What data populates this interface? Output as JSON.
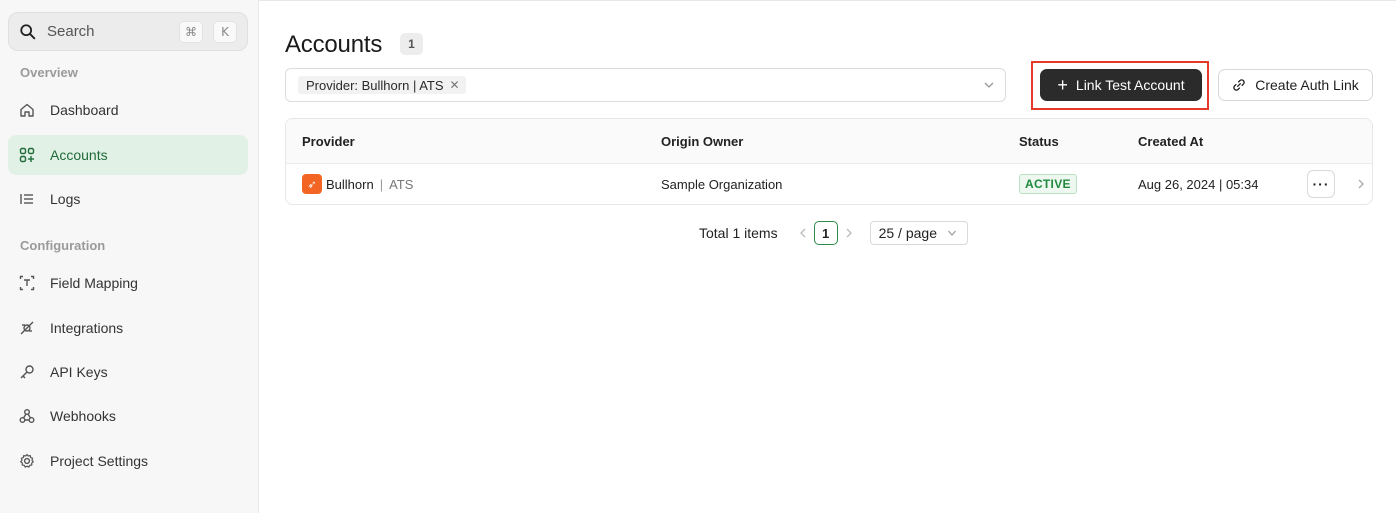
{
  "search": {
    "placeholder": "Search",
    "shortcut_mod": "⌘",
    "shortcut_key": "K"
  },
  "sidebar": {
    "sections": [
      {
        "label": "Overview"
      },
      {
        "label": "Configuration"
      }
    ],
    "items": [
      {
        "label": "Dashboard",
        "icon": "home-icon"
      },
      {
        "label": "Accounts",
        "icon": "accounts-icon",
        "active": true
      },
      {
        "label": "Logs",
        "icon": "logs-icon"
      },
      {
        "label": "Field Mapping",
        "icon": "field-mapping-icon"
      },
      {
        "label": "Integrations",
        "icon": "integrations-icon"
      },
      {
        "label": "API Keys",
        "icon": "key-icon"
      },
      {
        "label": "Webhooks",
        "icon": "webhook-icon"
      },
      {
        "label": "Project Settings",
        "icon": "gear-icon"
      }
    ]
  },
  "main": {
    "title": "Accounts",
    "count": "1",
    "filter": {
      "tag": "Provider: Bullhorn | ATS"
    },
    "buttons": {
      "link_test": "Link Test Account",
      "create_auth": "Create Auth Link"
    },
    "table": {
      "headers": [
        "Provider",
        "Origin Owner",
        "Status",
        "Created At"
      ],
      "rows": [
        {
          "provider": "Bullhorn",
          "sep": "|",
          "category": "ATS",
          "owner": "Sample Organization",
          "status": "ACTIVE",
          "created": "Aug 26, 2024 | 05:34"
        }
      ]
    },
    "pagination": {
      "total": "Total 1 items",
      "current": "1",
      "page_size": "25 / page"
    }
  },
  "colors": {
    "accent": "#2e8b4a",
    "active_bg": "#e2f1e6",
    "primary_button": "#2b2b2b",
    "highlight": "#e53a2a",
    "status_green": "#1f8a3d",
    "brand_bullhorn": "#f26522"
  }
}
